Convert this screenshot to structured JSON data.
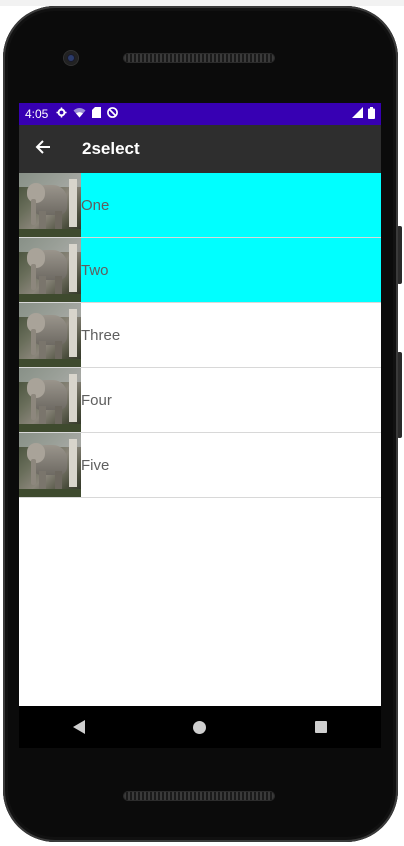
{
  "status_bar": {
    "time": "4:05",
    "icons_left": [
      "gear-icon",
      "wifi-icon",
      "sim-card-icon",
      "do-not-disturb-icon"
    ],
    "icons_right": [
      "cell-signal-icon",
      "battery-icon"
    ],
    "background_color": "#3700b3"
  },
  "app_bar": {
    "title": "2select",
    "back_icon": "arrow-left-icon",
    "background_color": "#2e2e2e"
  },
  "list": {
    "selected_color": "#00ffff",
    "items": [
      {
        "label": "One",
        "selected": true,
        "thumbnail": "elephant-image"
      },
      {
        "label": "Two",
        "selected": true,
        "thumbnail": "elephant-image"
      },
      {
        "label": "Three",
        "selected": false,
        "thumbnail": "elephant-image"
      },
      {
        "label": "Four",
        "selected": false,
        "thumbnail": "elephant-image"
      },
      {
        "label": "Five",
        "selected": false,
        "thumbnail": "elephant-image"
      }
    ]
  },
  "nav_bar": {
    "buttons": [
      "back-triangle-icon",
      "home-circle-icon",
      "recents-square-icon"
    ]
  }
}
